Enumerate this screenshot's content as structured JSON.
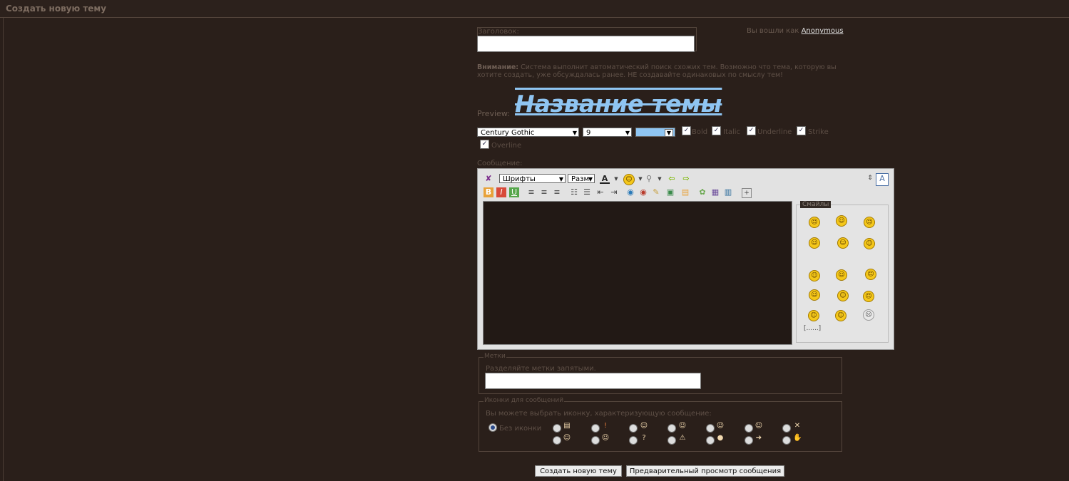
{
  "header": {
    "title": "Создать новую тему"
  },
  "form": {
    "title_label": "Заголовок:",
    "title_value": "",
    "login_prefix": "Вы вошли как",
    "login_user": "Anonymous",
    "warning_bold": "Внимание:",
    "warning_text": " Система выполнит автоматический поиск схожих тем. Возможно что тема, которую вы хотите создать, уже обсуждалась ранее. НЕ создавайте одинаковых по смыслу тем!",
    "preview_label": "Preview:",
    "preview_text": "Название темы",
    "font_select": "Century Gothic",
    "size_select": "9",
    "color_value": "#8fc5f2",
    "bold_label": "Bold",
    "italic_label": "Italic",
    "underline_label": "Underline",
    "strike_label": "Strike",
    "overline_label": "Overline",
    "message_label": "Сообщение:"
  },
  "editor": {
    "fonts_select": "Шрифты",
    "size_select": "Разм",
    "smileys_title": "Смайлы",
    "smileys_more": "[......]"
  },
  "tags": {
    "legend": "Метки",
    "hint": "Разделяйте метки запятыми.",
    "value": ""
  },
  "msg_icons": {
    "legend": "Иконки для сообщений",
    "hint": "Вы можете выбрать иконку, характеризующую сообщение:",
    "no_icon_label": "Без иконки"
  },
  "buttons": {
    "create": "Создать новую тему",
    "preview": "Предварительный просмотр сообщения"
  }
}
